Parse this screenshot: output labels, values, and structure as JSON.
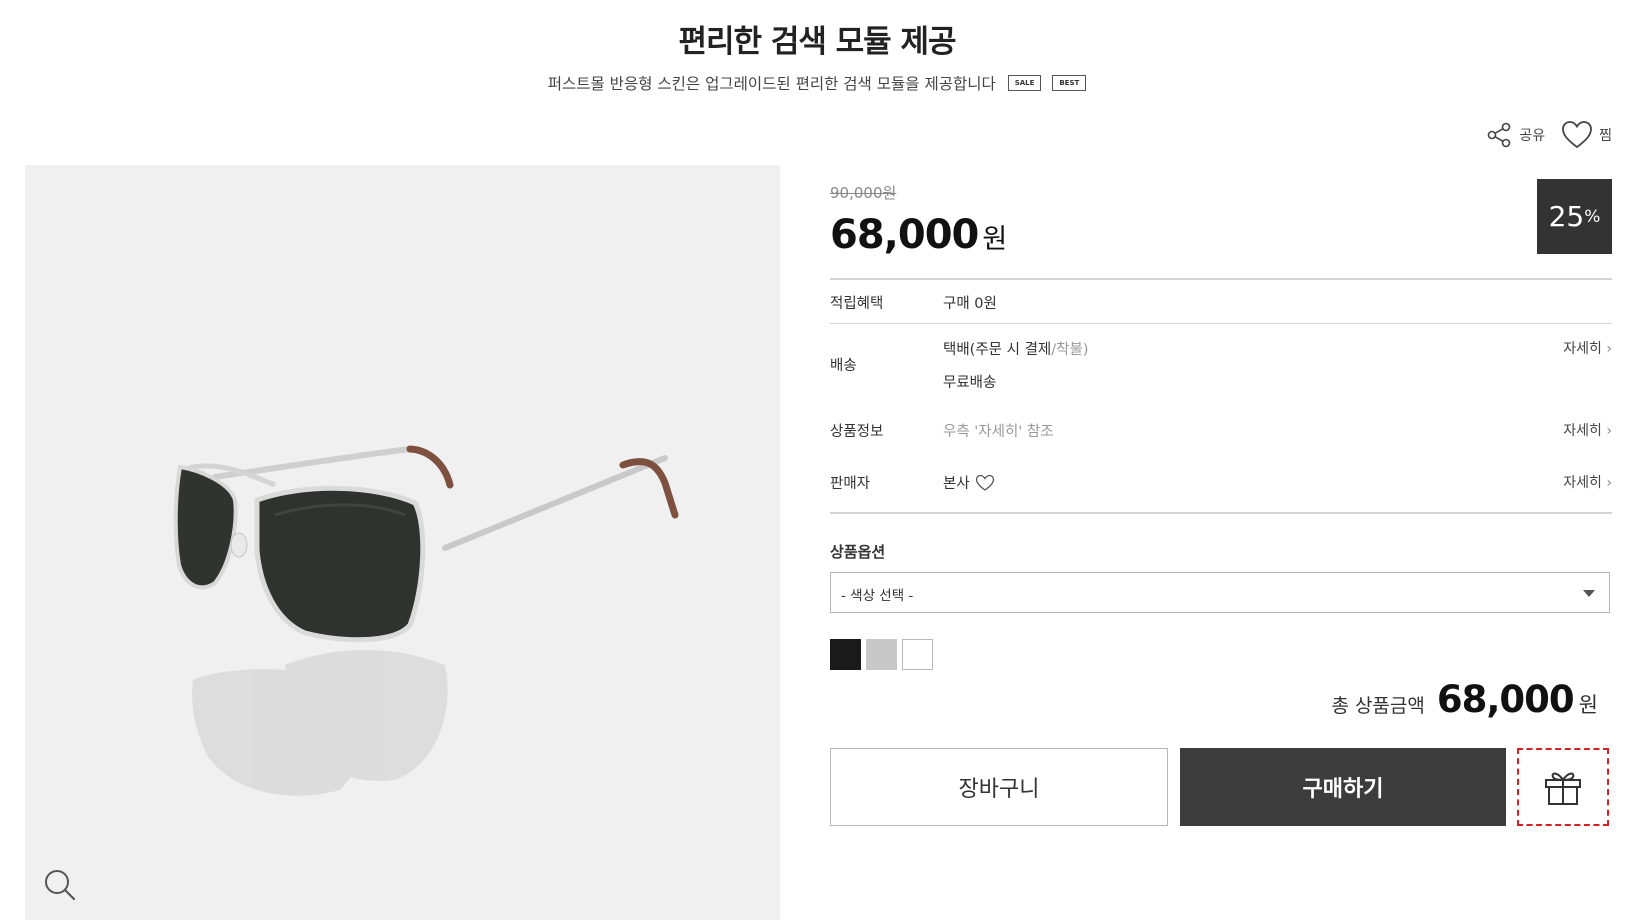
{
  "header": {
    "title": "편리한 검색 모듈 제공",
    "subtitle": "퍼스트몰 반응형 스킨은 업그레이드된 편리한 검색 모듈을 제공합니다",
    "badges": [
      "SALE",
      "BEST"
    ]
  },
  "tools": {
    "share_label": "공유",
    "wish_label": "찜"
  },
  "product": {
    "original_price": "90,000",
    "original_unit": "원",
    "price": "68,000",
    "price_unit": "원",
    "discount_value": "25",
    "discount_unit": "%"
  },
  "info_rows": {
    "points": {
      "label": "적립혜택",
      "value": "구매 0원"
    },
    "shipping": {
      "label": "배송",
      "method": "택배(주문 시 결제",
      "separator": "/",
      "method_extra": "착불)",
      "fee": "무료배송",
      "more": "자세히"
    },
    "product_info": {
      "label": "상품정보",
      "value": "우측 '자세히' 참조",
      "more": "자세히"
    },
    "seller": {
      "label": "판매자",
      "value": "본사",
      "more": "자세히"
    }
  },
  "options": {
    "title": "상품옵션",
    "select_value": "- 색상 선택 -",
    "swatch_colors": [
      "#1a1a1a",
      "#c8c8c8",
      "#ffffff"
    ]
  },
  "total": {
    "label": "총 상품금액",
    "amount": "68,000",
    "unit": "원"
  },
  "buttons": {
    "cart": "장바구니",
    "buy": "구매하기"
  },
  "colors": {
    "dark": "#3c3c3c",
    "highlight": "#d92020"
  }
}
